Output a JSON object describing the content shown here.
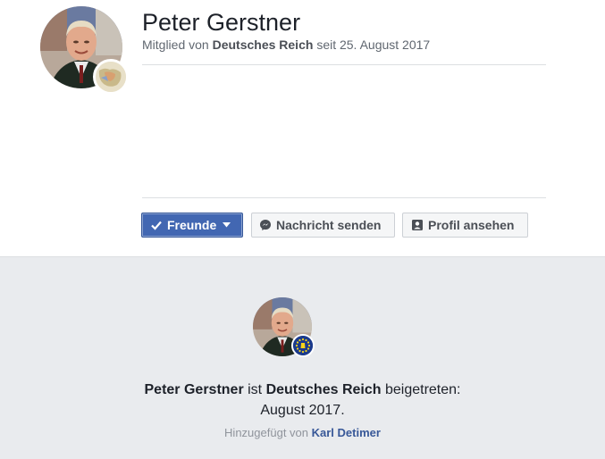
{
  "profile": {
    "name": "Peter Gerstner",
    "member_prefix": "Mitglied von",
    "group_name": "Deutsches Reich",
    "member_suffix": "seit 25. August 2017"
  },
  "actions": {
    "friends_label": "Freunde",
    "message_label": "Nachricht senden",
    "profile_label": "Profil ansehen"
  },
  "activity": {
    "name": "Peter Gerstner",
    "verb": "ist",
    "group_name": "Deutsches Reich",
    "joined_suffix": "beigetreten:",
    "date": "August 2017.",
    "added_by_prefix": "Hinzugefügt von",
    "added_by_name": "Karl Detimer"
  },
  "colors": {
    "primary_blue": "#4267b2",
    "link_blue": "#385898",
    "background_gray": "#e9ebee"
  },
  "icons": [
    "checkmark-icon",
    "caret-down-icon",
    "messenger-icon",
    "profile-card-icon"
  ]
}
